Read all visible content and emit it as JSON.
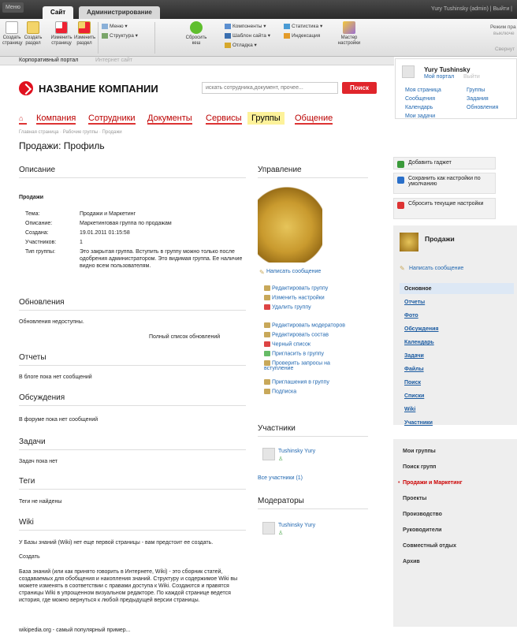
{
  "adminbar": {
    "menu": "Меню",
    "tab_site": "Сайт",
    "tab_admin": "Администрирование",
    "user": "Yury Tushinsky (admin)  |  Выйти  |"
  },
  "toolbar": {
    "create_page": "Создать\nстраницу",
    "create_section": "Создать\nраздел",
    "edit_page": "Изменить\nстраницу",
    "edit_section": "Изменить\nраздел",
    "menu": "Меню",
    "structure": "Структура",
    "reset_cache": "Сбросить\nкеш",
    "components": "Компоненты",
    "template": "Шаблон сайта",
    "debug": "Отладка",
    "stats": "Статистика",
    "index": "Индексация",
    "wizard": "Мастер\nнастройки",
    "mode": "Режим пра",
    "mode_sub": "выключе",
    "collapse": "Свернут"
  },
  "sitebar": {
    "portal": "Корпоративный портал",
    "shop": "Интернет сайт"
  },
  "header": {
    "company": "НАЗВАНИЕ КОМПАНИИ",
    "search_placeholder": "искать сотрудника,документ, прочее...",
    "search_btn": "Поиск"
  },
  "nav": [
    "Компания",
    "Сотрудники",
    "Документы",
    "Сервисы",
    "Группы",
    "Общение"
  ],
  "crumbs": "Главная страница · Рабочие группы · Продажи",
  "page_title": "Продажи: Профиль",
  "description": {
    "heading": "Описание",
    "name": "Продажи",
    "props": [
      {
        "label": "Тема:",
        "value": "Продажи и Маркетинг"
      },
      {
        "label": "Описание:",
        "value": "Маркетинговая группа по продажам"
      },
      {
        "label": "Создана:",
        "value": "19.01.2011 01:15:58"
      },
      {
        "label": "Участников:",
        "value": "1"
      },
      {
        "label": "Тип группы:",
        "value": "Это закрытая группа. Вступить в группу можно только после одобрения администратором. Это видимая группа. Ее наличие видно всем пользователям."
      }
    ]
  },
  "updates": {
    "heading": "Обновления",
    "text": "Обновления недоступны.",
    "link": "Полный список обновлений"
  },
  "reports": {
    "heading": "Отчеты",
    "text": "В блоге пока нет сообщений"
  },
  "discussions": {
    "heading": "Обсуждения",
    "text": "В форуме пока нет сообщений"
  },
  "tasks": {
    "heading": "Задачи",
    "text": "Задач пока нет"
  },
  "tags": {
    "heading": "Теги",
    "text": "Теги не найдены"
  },
  "wiki": {
    "heading": "Wiki",
    "text1": "У Базы знаний (Wiki) нет еще первой страницы - вам предстоит ее создать.",
    "create": "Создать",
    "text2": "База знаний (или как принято говорить в Интернете, Wiki) - это сборник статей, создаваемых для обобщения и накопления знаний. Структуру и содержимое Wiki вы можете изменять в соответствии с правами доступа к Wiki. Создаются и правятся страницы Wiki в упрощенном визуальном редакторе. По каждой странице ведется история, где можно вернуться к любой предыдущей версии страницы.",
    "text3": "wikipedia.org - самый популярный пример..."
  },
  "manage": {
    "heading": "Управление",
    "write": "Написать сообщение",
    "actions": [
      "Редактировать группу",
      "Изменить настройки",
      "Удалить группу",
      "Редактировать модераторов",
      "Редактировать состав",
      "Черный список",
      "Пригласить в группу",
      "Проверить запросы на вступление",
      "Приглашения в группу",
      "Подписка"
    ]
  },
  "members": {
    "heading": "Участники",
    "name": "Tushinsky Yury",
    "all": "Все участники (1)"
  },
  "moderators": {
    "heading": "Модераторы",
    "name": "Tushinsky Yury"
  },
  "userbox": {
    "name": "Yury Tushinsky",
    "portal": "Мой портал",
    "logout": "Выйти",
    "links": [
      "Моя страница",
      "Группы",
      "Сообщения",
      "Задания",
      "Календарь",
      "Обновления",
      "Мои задачи"
    ]
  },
  "gadgets": [
    "Добавить гаджет",
    "Сохранить как настройки по умолчанию",
    "Сбросить текущие настройки"
  ],
  "group": {
    "title": "Продажи",
    "write": "Написать сообщение"
  },
  "sidemenu": [
    "Основное",
    "Отчеты",
    "Фото",
    "Обсуждения",
    "Календарь",
    "Задачи",
    "Файлы",
    "Поиск",
    "Списки",
    "Wiki",
    "Участники"
  ],
  "groups": [
    "Мои группы",
    "Поиск групп",
    "Продажи и Маркетинг",
    "Проекты",
    "Производство",
    "Руководители",
    "Совместный отдых",
    "Архив"
  ]
}
